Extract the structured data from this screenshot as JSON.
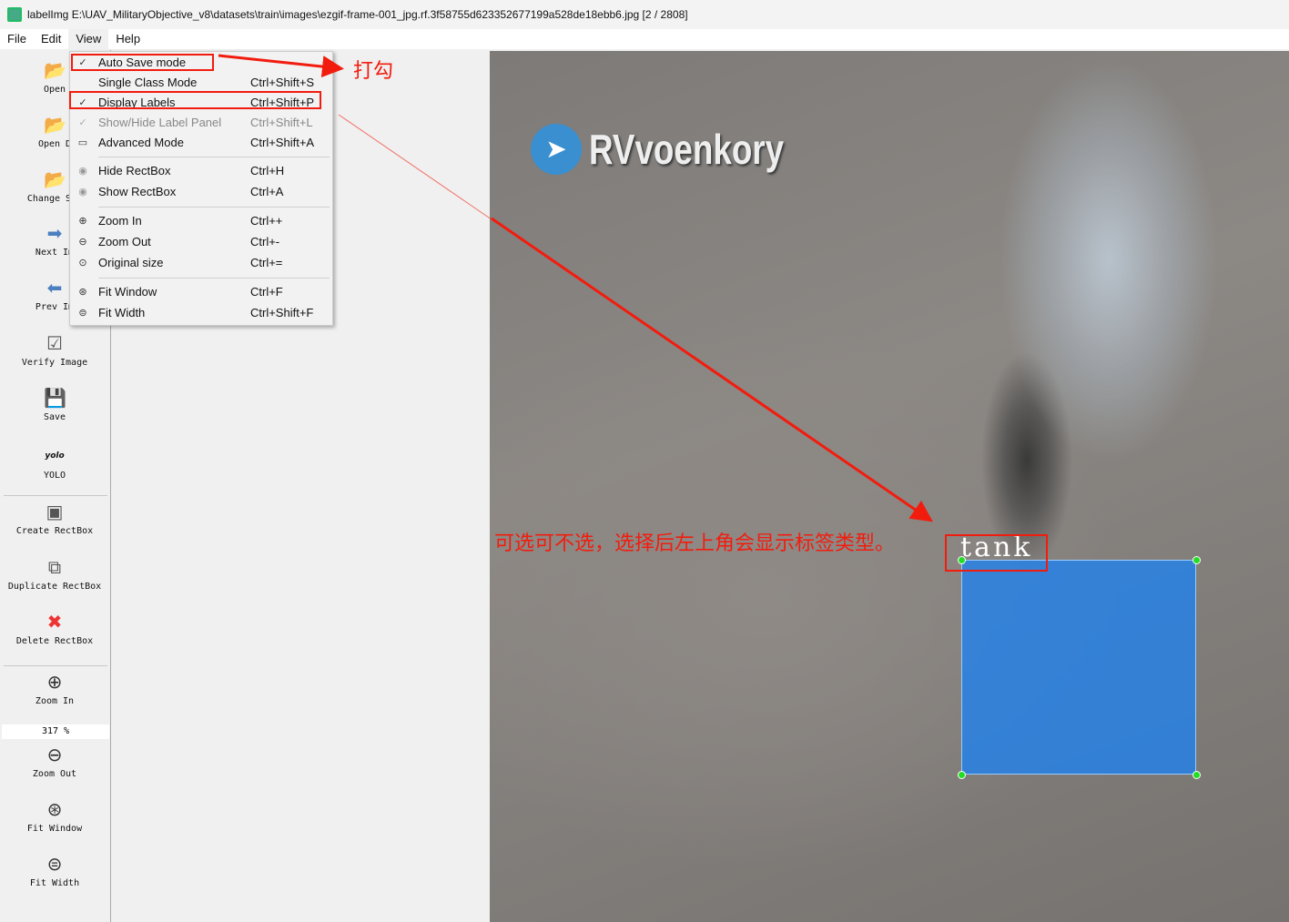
{
  "window": {
    "title": "labelImg E:\\UAV_MilitaryObjective_v8\\datasets\\train\\images\\ezgif-frame-001_jpg.rf.3f58755d623352677199a528de18ebb6.jpg [2 / 2808]"
  },
  "menubar": [
    "File",
    "Edit",
    "View",
    "Help"
  ],
  "toolbar": {
    "open": "Open",
    "open_dir": "Open D",
    "change_save": "Change Sav",
    "next": "Next Im",
    "prev": "Prev Im",
    "verify": "Verify Image",
    "save": "Save",
    "yolo_icon": "yolo",
    "yolo": "YOLO",
    "create": "Create RectBox",
    "duplicate": "Duplicate RectBox",
    "delete": "Delete RectBox",
    "zoom_in": "Zoom In",
    "zoom_value": "317 %",
    "zoom_out": "Zoom Out",
    "fit_window": "Fit Window",
    "fit_width": "Fit Width"
  },
  "view_menu": [
    {
      "label": "Auto Save mode",
      "shortcut": "",
      "checked": true
    },
    {
      "label": "Single Class Mode",
      "shortcut": "Ctrl+Shift+S"
    },
    {
      "label": "Display Labels",
      "shortcut": "Ctrl+Shift+P",
      "checked": true
    },
    {
      "label": "Show/Hide Label Panel",
      "shortcut": "Ctrl+Shift+L",
      "disabled": true
    },
    {
      "label": "Advanced Mode",
      "shortcut": "Ctrl+Shift+A"
    },
    {
      "label": "Hide RectBox",
      "shortcut": "Ctrl+H"
    },
    {
      "label": "Show RectBox",
      "shortcut": "Ctrl+A"
    },
    {
      "label": "Zoom In",
      "shortcut": "Ctrl++"
    },
    {
      "label": "Zoom Out",
      "shortcut": "Ctrl+-"
    },
    {
      "label": "Original size",
      "shortcut": "Ctrl+="
    },
    {
      "label": "Fit Window",
      "shortcut": "Ctrl+F"
    },
    {
      "label": "Fit Width",
      "shortcut": "Ctrl+Shift+F"
    }
  ],
  "canvas": {
    "watermark": "RVvoenkory",
    "box_label": "tank"
  },
  "annotations": {
    "check_note": "打勾",
    "label_note": "可选可不选，选择后左上角会显示标签类型。"
  },
  "colors": {
    "annotation": "#f21c0e",
    "bbox_fill": "#1e82f0"
  }
}
